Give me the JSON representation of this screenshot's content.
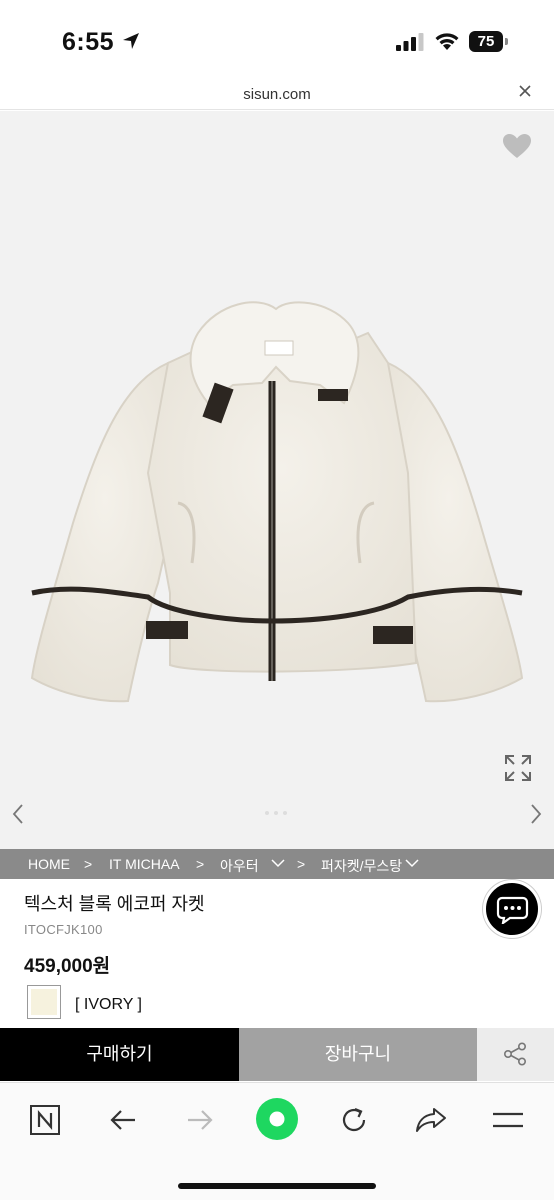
{
  "status_bar": {
    "time": "6:55",
    "battery": "75",
    "icons": [
      "location-arrow-icon",
      "signal-icon",
      "wifi-icon",
      "battery-icon"
    ]
  },
  "browser": {
    "url": "sisun.com",
    "close_icon": "close-icon"
  },
  "gallery": {
    "icons": [
      "heart-icon",
      "expand-icon",
      "chevron-left-icon",
      "chevron-right-icon"
    ],
    "dot_count": 3,
    "active_dot": 0
  },
  "breadcrumb": {
    "items": [
      {
        "label": "HOME",
        "sep": ">"
      },
      {
        "label": "IT MICHAA",
        "sep": ">"
      },
      {
        "label": "아우터",
        "sep": ">"
      },
      {
        "label": "퍼자켓/무스탕",
        "sep": ""
      }
    ]
  },
  "product": {
    "name": "텍스처 블록 에코퍼 자켓",
    "code": "ITOCFJK100",
    "price": "459,000원",
    "color_label": "[ IVORY ]",
    "swatch_color": "#f6f2de"
  },
  "actions": {
    "buy_label": "구매하기",
    "cart_label": "장바구니",
    "buy_bg": "#000000",
    "cart_bg": "#a2a2a2"
  },
  "toolbar": {
    "icons": [
      "naver-n-icon",
      "back-arrow-icon",
      "forward-arrow-icon",
      "green-home-icon",
      "reload-icon",
      "share-arrow-icon",
      "menu-icon"
    ],
    "accent": "#1ed760"
  },
  "chat": {
    "icon": "chat-bubble-icon"
  }
}
